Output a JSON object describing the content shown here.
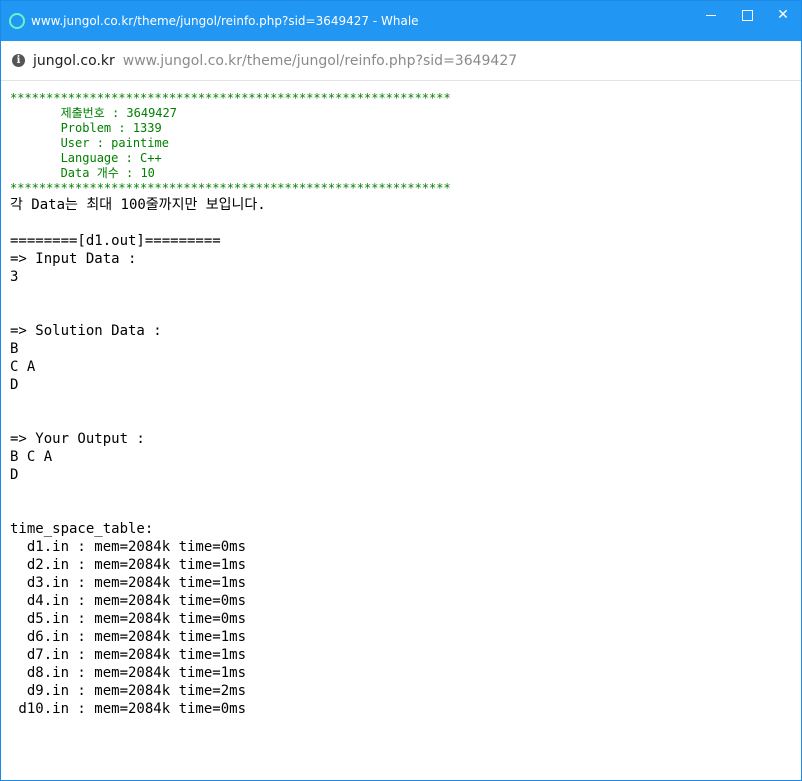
{
  "window": {
    "title": "www.jungol.co.kr/theme/jungol/reinfo.php?sid=3649427 - Whale"
  },
  "address_bar": {
    "domain": "jungol.co.kr",
    "url": "www.jungol.co.kr/theme/jungol/reinfo.php?sid=3649427"
  },
  "report": {
    "stars": "*************************************************************",
    "submission": "       제출번호 : 3649427",
    "problem": "       Problem : 1339",
    "user": "       User : paintime",
    "language": "       Language : C++",
    "data_count": "       Data 개수 : 10",
    "note": "각 Data는 최대 100줄까지만 보입니다.",
    "section_header": "========[d1.out]=========",
    "input_label": "=> Input Data :",
    "input_value": "3",
    "solution_label": "=> Solution Data :",
    "solution_lines": [
      "B",
      "C A",
      "D"
    ],
    "output_label": "=> Your Output :",
    "output_lines": [
      "B C A",
      "D"
    ],
    "table_label": "time_space_table:",
    "table_rows": [
      "  d1.in : mem=2084k time=0ms",
      "  d2.in : mem=2084k time=1ms",
      "  d3.in : mem=2084k time=1ms",
      "  d4.in : mem=2084k time=0ms",
      "  d5.in : mem=2084k time=0ms",
      "  d6.in : mem=2084k time=1ms",
      "  d7.in : mem=2084k time=1ms",
      "  d8.in : mem=2084k time=1ms",
      "  d9.in : mem=2084k time=2ms",
      " d10.in : mem=2084k time=0ms"
    ]
  }
}
